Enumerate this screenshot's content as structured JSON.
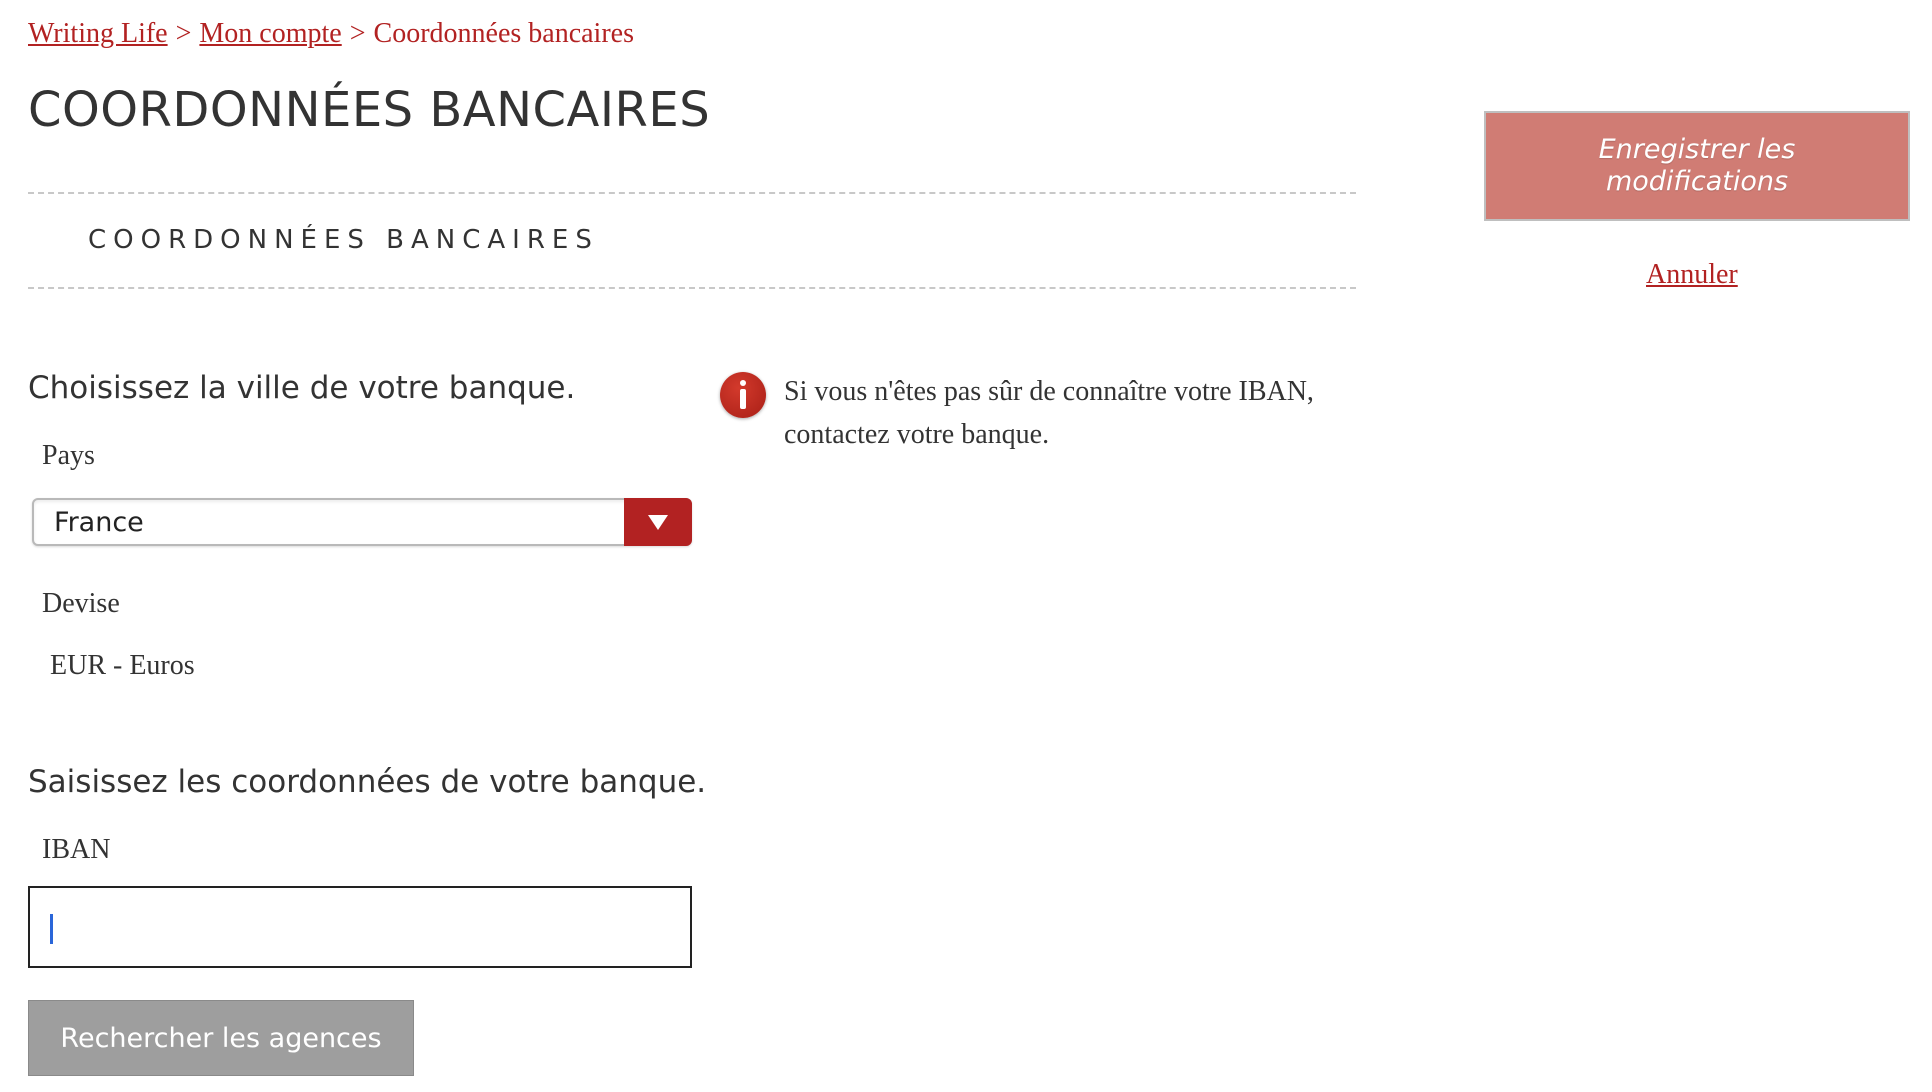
{
  "breadcrumb": {
    "items": [
      "Writing Life",
      "Mon compte",
      "Coordonnées bancaires"
    ],
    "separator": ">"
  },
  "page": {
    "title": "COORDONNÉES BANCAIRES",
    "section_heading": "COORDONNÉES BANCAIRES"
  },
  "bank_location": {
    "heading": "Choisissez la ville de votre banque.",
    "country_label": "Pays",
    "country_value": "France",
    "currency_label": "Devise",
    "currency_value": "EUR - Euros"
  },
  "bank_details": {
    "heading": "Saisissez les coordonnées de votre banque.",
    "iban_label": "IBAN",
    "iban_value": "",
    "search_button": "Rechercher les agences"
  },
  "info": {
    "icon": "info-icon",
    "text": "Si vous n'êtes pas sûr de connaître votre IBAN, contactez votre banque."
  },
  "actions": {
    "save_label": "Enregistrer les modifications",
    "cancel_label": "Annuler"
  },
  "colors": {
    "accent": "#b22222",
    "save_button_bg": "#d07c74",
    "search_button_bg": "#9e9e9e"
  }
}
